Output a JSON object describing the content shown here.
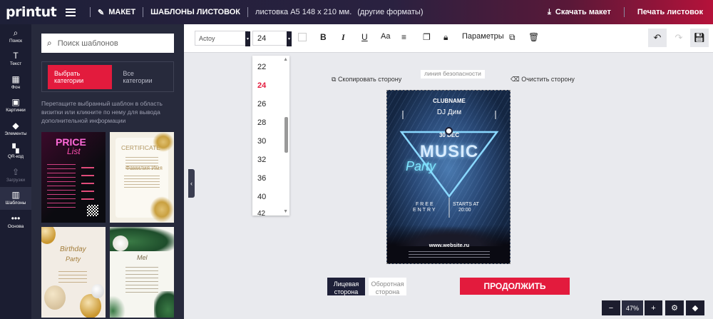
{
  "header": {
    "logo": "printut",
    "maket": "МАКЕТ",
    "templates": "ШАБЛОНЫ ЛИСТОВОК",
    "product": "листовка А5 148 x 210 мм.",
    "formats": "(другие форматы)",
    "download": "Скачать макет",
    "print": "Печать листовок"
  },
  "sidebar": {
    "items": [
      {
        "label": "Поиск",
        "icon": "search-icon"
      },
      {
        "label": "Текст",
        "icon": "text-icon"
      },
      {
        "label": "Фон",
        "icon": "background-icon"
      },
      {
        "label": "Картинки",
        "icon": "image-icon"
      },
      {
        "label": "Элементы",
        "icon": "shapes-icon"
      },
      {
        "label": "QR-код",
        "icon": "qr-icon"
      },
      {
        "label": "Загрузки",
        "icon": "upload-icon"
      },
      {
        "label": "Шаблоны",
        "icon": "templates-icon"
      },
      {
        "label": "Основа",
        "icon": "more-icon"
      }
    ]
  },
  "panel": {
    "search_placeholder": "Поиск шаблонов",
    "tab_select": "Выбрать категории",
    "tab_all": "Все категории",
    "hint": "Перетащите выбранный шаблон в область визитки или кликните по нему для вывода дополнительной информации"
  },
  "thumbs": {
    "t1_title": "PRICE",
    "t1_sub": "List",
    "t2_title": "CERTIFICATE",
    "t2_name": "Фамилия Имя",
    "t3_title": "Birthday",
    "t3_sub": "Party",
    "t4_title": "Mel"
  },
  "toolbar": {
    "font": "Actoy",
    "size": "24",
    "bold": "B",
    "italic": "I",
    "underline": "U",
    "case": "Aa",
    "params": "Параметры"
  },
  "dropdown": {
    "sizes": [
      "22",
      "24",
      "26",
      "28",
      "30",
      "32",
      "36",
      "40",
      "42"
    ],
    "selected": "24"
  },
  "canvas": {
    "copy_side": "Скопировать сторону",
    "safe_line": "линия безопасности",
    "clear_side": "Очистить сторону"
  },
  "flyer": {
    "clubname": "CLUBNAME",
    "dj": "DJ Дим",
    "date": "30 DEC",
    "music": "MUSIC",
    "party": "Party",
    "free": "FREE",
    "entry": "ENTRY",
    "starts": "STARTS AT",
    "time": "20:00",
    "website": "www.website.ru"
  },
  "bottom": {
    "front": "Лицевая сторона",
    "back": "Оборотная сторона",
    "continue": "ПРОДОЛЖИТЬ"
  },
  "zoom": {
    "minus": "−",
    "level": "47%",
    "plus": "+"
  }
}
